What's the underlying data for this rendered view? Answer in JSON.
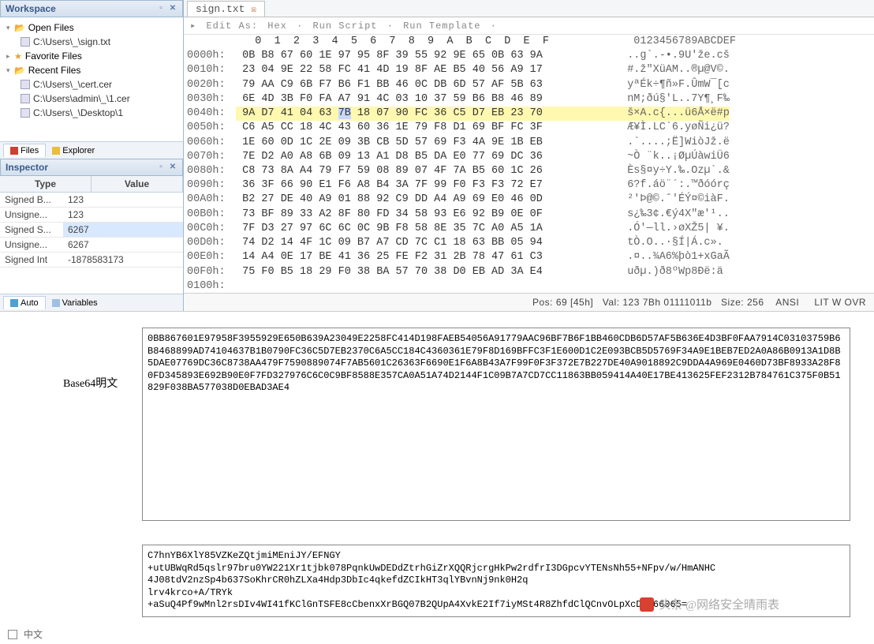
{
  "workspace": {
    "title": "Workspace",
    "open_files": {
      "label": "Open Files",
      "items": [
        "C:\\Users\\_\\sign.txt"
      ]
    },
    "favorite_files": {
      "label": "Favorite Files"
    },
    "recent_files": {
      "label": "Recent Files",
      "items": [
        "C:\\Users\\_\\cert.cer",
        "C:\\Users\\admin\\_\\1.cer",
        "C:\\Users\\_\\Desktop\\1"
      ]
    },
    "tabs": {
      "files": "Files",
      "explorer": "Explorer"
    }
  },
  "inspector": {
    "title": "Inspector",
    "headers": {
      "type": "Type",
      "value": "Value"
    },
    "rows": [
      {
        "type": "Signed B...",
        "value": "123"
      },
      {
        "type": "Unsigne...",
        "value": "123"
      },
      {
        "type": "Signed S...",
        "value": "6267"
      },
      {
        "type": "Unsigne...",
        "value": "6267"
      },
      {
        "type": "Signed Int",
        "value": "-1878583173"
      }
    ],
    "tabs": {
      "auto": "Auto",
      "variables": "Variables"
    }
  },
  "editor": {
    "file_tab": "sign.txt",
    "toolbar": {
      "edit_as": "Edit As:",
      "hex": "Hex",
      "run_script": "Run Script",
      "run_template": "Run Template"
    },
    "col_header_hex": "   0  1  2  3  4  5  6  7  8  9  A  B  C  D  E  F",
    "col_header_ascii": "0123456789ABCDEF",
    "rows": [
      {
        "addr": "0000h:",
        "hex": "0B B8 67 60 1E 97 95 8F 39 55 92 9E 65 0B 63 9A",
        "ascii": "..g`.-•.9U'žе.сš"
      },
      {
        "addr": "0010h:",
        "hex": "23 04 9E 22 58 FC 41 4D 19 8F AE B5 40 56 A9 17",
        "ascii": "#.ž\"XüAM..®µ@V©."
      },
      {
        "addr": "0020h:",
        "hex": "79 AA C9 6B F7 B6 F1 BB 46 0C DB 6D 57 AF 5B 63",
        "ascii": "yªÉk÷¶ñ»F.ÛmW¯[c"
      },
      {
        "addr": "0030h:",
        "hex": "6E 4D 3B F0 FA A7 91 4C 03 10 37 59 B6 B8 46 89",
        "ascii": "nM;ðú§'L..7Y¶¸F‰"
      },
      {
        "addr": "0040h:",
        "hex": "9A D7 41 04 63 7B 18 07 90 FC 36 C5 D7 EB 23 70",
        "ascii": "š×A.c{...ü6Å×ë#p",
        "hl": true
      },
      {
        "addr": "0050h:",
        "hex": "C6 A5 CC 18 4C 43 60 36 1E 79 F8 D1 69 BF FC 3F",
        "ascii": "Æ¥Ì.LC`6.yøÑi¿ü?"
      },
      {
        "addr": "0060h:",
        "hex": "1E 60 0D 1C 2E 09 3B CB 5D 57 69 F3 4A 9E 1B EB",
        "ascii": ".`....;Ë]WiòJž.ë"
      },
      {
        "addr": "0070h:",
        "hex": "7E D2 A0 A8 6B 09 13 A1 D8 B5 DA E0 77 69 DC 36",
        "ascii": "~Ò ¨k..¡ØµÚàwiÜ6"
      },
      {
        "addr": "0080h:",
        "hex": "C8 73 8A A4 79 F7 59 08 89 07 4F 7A B5 60 1C 26",
        "ascii": "Ès§¤y÷Y.‰.Ozµ`.&"
      },
      {
        "addr": "0090h:",
        "hex": "36 3F 66 90 E1 F6 A8 B4 3A 7F 99 F0 F3 F3 72 E7",
        "ascii": "6?f.áö¨´:.™ðóórç"
      },
      {
        "addr": "00A0h:",
        "hex": "B2 27 DE 40 A9 01 88 92 C9 DD A4 A9 69 E0 46 0D",
        "ascii": "²'Þ@©.ˆ'ÉÝ¤©iàF."
      },
      {
        "addr": "00B0h:",
        "hex": "73 BF 89 33 A2 8F 80 FD 34 58 93 E6 92 B9 0E 0F",
        "ascii": "s¿‰3¢.€ý4X\"æ'¹.."
      },
      {
        "addr": "00C0h:",
        "hex": "7F D3 27 97 6C 6C 0C 9B F8 58 8E 35 7C A0 A5 1A",
        "ascii": ".Ó'—ll.›øXŽ5| ¥."
      },
      {
        "addr": "00D0h:",
        "hex": "74 D2 14 4F 1C 09 B7 A7 CD 7C C1 18 63 BB 05 94",
        "ascii": "tÒ.O..·§Í|Á.c»."
      },
      {
        "addr": "00E0h:",
        "hex": "14 A4 0E 17 BE 41 36 25 FE F2 31 2B 78 47 61 C3",
        "ascii": ".¤..¾A6%þò1+xGaÃ"
      },
      {
        "addr": "00F0h:",
        "hex": "75 F0 B5 18 29 F0 38 BA 57 70 38 D0 EB AD 3A E4",
        "ascii": "uðµ.)ð8ºWp8Ðë­:ä"
      },
      {
        "addr": "0100h:",
        "hex": "",
        "ascii": ""
      }
    ]
  },
  "status_bar": {
    "pos_label": "Pos:",
    "pos": "69 [45h]",
    "val_label": "Val:",
    "val": "123 7Bh 01111011b",
    "size_label": "Size:",
    "size": "256",
    "enc": "ANSI",
    "mode": "LIT  W  OVR"
  },
  "bottom": {
    "base64_label": "Base64明文",
    "hex_blob": "0BB867601E97958F3955929E650B639A23049E2258FC414D198FAEB54056A91779AAC96BF7B6F1BB460CDB6D57AF5B636E4D3BF0FAA7914C03103759B6B8468899AD74104637B1B0790FC36C5D7EB2370C6A5CC184C4360361E79F8D169BFFC3F1E600D1C2E093BCB5D5769F34A9E1BEB7ED2A0A86B0913A1D8B5DAE07769DC36C8738AA479F7590889074F7AB5601C26363F6690E1F6A8B43A7F99F0F3F372E7B227DE40A9018892C9DDA4A969E0460D73BF8933A28F80FD345893E692B90E0F7FD327976C6C0C9BF8588E357CA0A51A74D2144F1C09B7A7CD7CC11863BB059414A40E17BE413625FEF2312B784761C375F0B51829F038BA577038D0EBAD3AE4",
    "b64_lines": [
      "C7hnYB6XlY85VZKeZQtjmiMEniJY/EFNGY",
      "+utUBWqRd5qslr97bru0YW221Xr1tjbk078PqnkUwDEDdZtrhGiZrXQQRjcrgHkPw2rdfrI3DGpcvYTENsNh55+NFpv/w/HmANHC",
      "4J08tdV2nzSp4b637SoKhrCR0hZLXa4Hdp3DbIc4qkefdZCIkHT3qlYBvnNj9nk0H2q",
      "lrv4krco+A/TRYk",
      "+aSuQ4Pf9wMnl2rsDIv4WI41fKClGnTSFE8cCbenxXrBGQ07B2QUpA4XvkE2If7iyMSt4R8ZhfdClQCnvOLpXcDjQ66065="
    ]
  },
  "watermark": "头条 @网络安全晴雨表",
  "bottom_strip": "中文"
}
